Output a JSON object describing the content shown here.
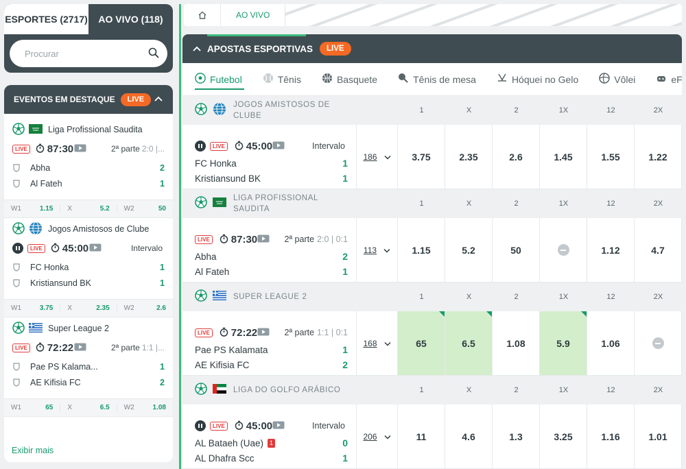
{
  "top_tabs": [
    {
      "label": "ESPORTES (2717)",
      "active": true
    },
    {
      "label": "AO VIVO (118)",
      "active": false
    }
  ],
  "search": {
    "placeholder": "Procurar"
  },
  "featured": {
    "title": "EVENTOS EM DESTAQUE",
    "live": "LIVE",
    "show_more": "Exibir mais",
    "events": [
      {
        "league": "Liga Profissional Saudita",
        "live": "LIVE",
        "paused": false,
        "clock": "87:30",
        "part": "2ª parte",
        "part_score": "2:0 |...",
        "teams": [
          {
            "name": "Abha",
            "score": "2"
          },
          {
            "name": "Al Fateh",
            "score": "1"
          }
        ],
        "odds": [
          {
            "k": "W1",
            "v": "1.15"
          },
          {
            "k": "X",
            "v": "5.2"
          },
          {
            "k": "W2",
            "v": "50"
          }
        ]
      },
      {
        "league": "Jogos Amistosos de Clube",
        "live": "LIVE",
        "paused": true,
        "clock": "45:00",
        "part": "Intervalo",
        "part_score": "",
        "teams": [
          {
            "name": "FC Honka",
            "score": "1"
          },
          {
            "name": "Kristiansund BK",
            "score": "1"
          }
        ],
        "odds": [
          {
            "k": "W1",
            "v": "3.75"
          },
          {
            "k": "X",
            "v": "2.35"
          },
          {
            "k": "W2",
            "v": "2.6"
          }
        ]
      },
      {
        "league": "Super League 2",
        "live": "LIVE",
        "paused": false,
        "clock": "72:22",
        "part": "2ª parte",
        "part_score": "1:1 |...",
        "teams": [
          {
            "name": "Pae PS Kalama...",
            "score": "1"
          },
          {
            "name": "AE Kifisia FC",
            "score": "2"
          }
        ],
        "odds": [
          {
            "k": "W1",
            "v": "65"
          },
          {
            "k": "X",
            "v": "6.5"
          },
          {
            "k": "W2",
            "v": "1.08"
          }
        ]
      }
    ]
  },
  "breadcrumb": {
    "current": "AO VIVO"
  },
  "main": {
    "title": "APOSTAS ESPORTIVAS",
    "live": "LIVE",
    "sports": [
      "Futebol",
      "Tênis",
      "Basquete",
      "Tênis de mesa",
      "Hóquei no Gelo",
      "Vôlei",
      "eFu"
    ],
    "columns": [
      "1",
      "X",
      "2",
      "1X",
      "12",
      "2X"
    ],
    "leagues": [
      {
        "name": "JOGOS AMISTOSOS DE CLUBE",
        "flag": "globe",
        "match": {
          "paused": true,
          "live": "LIVE",
          "clock": "45:00",
          "part": "Intervalo",
          "part_score": "",
          "teams": [
            {
              "name": "FC Honka",
              "score": "1",
              "red": ""
            },
            {
              "name": "Kristiansund BK",
              "score": "1",
              "red": ""
            }
          ],
          "more": "186",
          "odds": [
            "3.75",
            "2.35",
            "2.6",
            "1.45",
            "1.55",
            "1.22"
          ],
          "highlight": [
            false,
            false,
            false,
            false,
            false,
            false
          ]
        }
      },
      {
        "name": "LIGA PROFISSIONAL SAUDITA",
        "flag": "saudi",
        "match": {
          "paused": false,
          "live": "LIVE",
          "clock": "87:30",
          "part": "2ª parte",
          "part_score": "2:0 | 0:1",
          "teams": [
            {
              "name": "Abha",
              "score": "2",
              "red": ""
            },
            {
              "name": "Al Fateh",
              "score": "1",
              "red": ""
            }
          ],
          "more": "113",
          "odds": [
            "1.15",
            "5.2",
            "50",
            "",
            "1.12",
            "4.7"
          ],
          "highlight": [
            false,
            false,
            false,
            false,
            false,
            false
          ]
        }
      },
      {
        "name": "SUPER LEAGUE 2",
        "flag": "greece",
        "match": {
          "paused": false,
          "live": "LIVE",
          "clock": "72:22",
          "part": "2ª parte",
          "part_score": "1:1 | 0:1",
          "teams": [
            {
              "name": "Pae PS Kalamata",
              "score": "1",
              "red": ""
            },
            {
              "name": "AE Kifisia FC",
              "score": "2",
              "red": ""
            }
          ],
          "more": "168",
          "odds": [
            "65",
            "6.5",
            "1.08",
            "5.9",
            "1.06",
            ""
          ],
          "highlight": [
            true,
            true,
            false,
            true,
            false,
            false
          ]
        }
      },
      {
        "name": "LIGA DO GOLFO ARÁBICO",
        "flag": "uae",
        "match": {
          "paused": true,
          "live": "LIVE",
          "clock": "45:00",
          "part": "Intervalo",
          "part_score": "",
          "teams": [
            {
              "name": "AL Bataeh (Uae)",
              "score": "0",
              "red": "1"
            },
            {
              "name": "AL Dhafra Scc",
              "score": "1",
              "red": ""
            }
          ],
          "more": "206",
          "odds": [
            "11",
            "4.6",
            "1.3",
            "3.25",
            "1.16",
            "1.01"
          ],
          "highlight": [
            false,
            false,
            false,
            false,
            false,
            false
          ]
        }
      }
    ]
  }
}
